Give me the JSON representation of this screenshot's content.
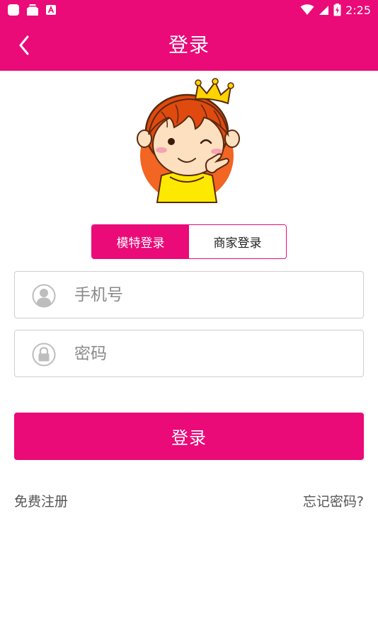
{
  "status_bar": {
    "time": "2:25",
    "icons": [
      "app-notification-icon",
      "store-notification-icon",
      "font-app-notification-icon",
      "wifi-icon",
      "signal-icon",
      "battery-charging-icon"
    ]
  },
  "app_bar": {
    "title": "登录",
    "back_icon": "chevron-left-icon"
  },
  "mascot": {
    "description_icon": "girl-with-crown-mascot"
  },
  "login_type": {
    "tabs": [
      {
        "label": "模特登录",
        "active": true
      },
      {
        "label": "商家登录",
        "active": false
      }
    ]
  },
  "form": {
    "phone": {
      "placeholder": "手机号",
      "value": "",
      "icon": "user-icon"
    },
    "password": {
      "placeholder": "密码",
      "value": "",
      "icon": "lock-icon"
    },
    "submit_label": "登录"
  },
  "links": {
    "register": "免费注册",
    "forgot": "忘记密码?"
  },
  "colors": {
    "brand": "#ea0a78",
    "field_border": "#cfcfcf",
    "link_text": "#555555"
  }
}
